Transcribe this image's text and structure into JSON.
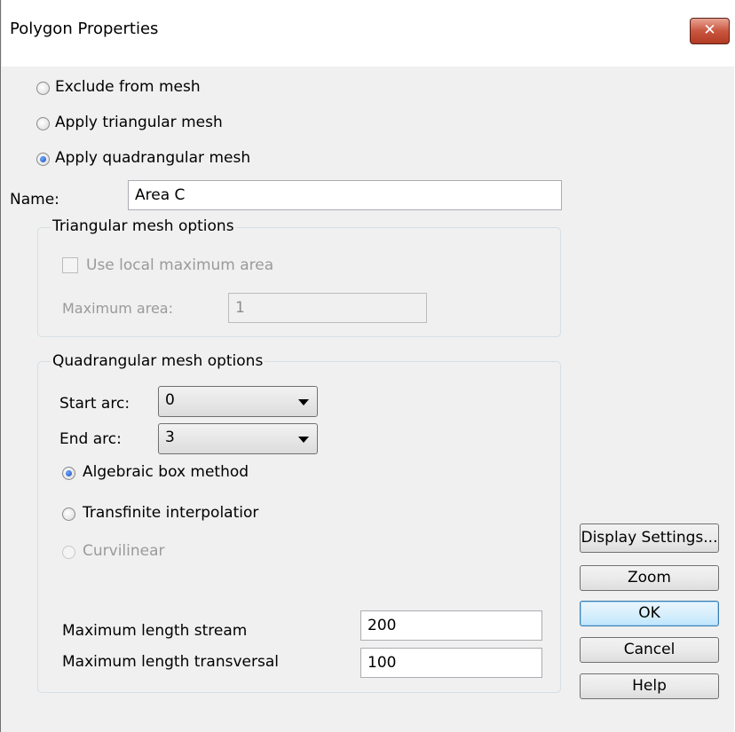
{
  "window": {
    "title": "Polygon Properties",
    "close_label": "✕"
  },
  "mesh_mode": {
    "options": [
      {
        "label": "Exclude from mesh",
        "checked": false
      },
      {
        "label": "Apply triangular mesh",
        "checked": false
      },
      {
        "label": "Apply quadrangular mesh",
        "checked": true
      }
    ]
  },
  "name_field": {
    "label": "Name:",
    "value": "Area C"
  },
  "triangular": {
    "legend": "Triangular mesh options",
    "use_local_label": "Use local maximum area",
    "max_area_label": "Maximum area:",
    "max_area_value": "1"
  },
  "quadrangular": {
    "legend": "Quadrangular mesh options",
    "start_arc_label": "Start arc:",
    "start_arc_value": "0",
    "end_arc_label": "End arc:",
    "end_arc_value": "3",
    "methods": [
      {
        "label": "Algebraic box method",
        "checked": true,
        "enabled": true
      },
      {
        "label": "Transfinite interpolatior",
        "checked": false,
        "enabled": true
      },
      {
        "label": "Curvilinear",
        "checked": false,
        "enabled": false
      }
    ],
    "max_stream_label": "Maximum length stream",
    "max_stream_value": "200",
    "max_transversal_label": "Maximum length transversal",
    "max_transversal_value": "100"
  },
  "buttons": {
    "display_settings": "Display Settings...",
    "zoom": "Zoom",
    "ok": "OK",
    "cancel": "Cancel",
    "help": "Help"
  }
}
